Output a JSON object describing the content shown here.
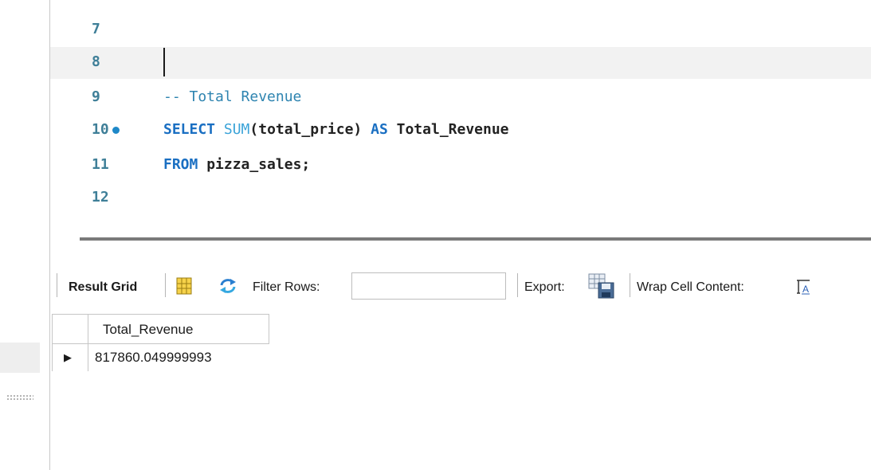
{
  "editor": {
    "lines": [
      {
        "num": "7"
      },
      {
        "num": "8"
      },
      {
        "num": "9",
        "comment": "-- Total Revenue"
      },
      {
        "num": "10",
        "kw_select": "SELECT",
        "fn_sum": "SUM",
        "expr": "(total_price) ",
        "kw_as": "AS",
        "alias": " Total_Revenue"
      },
      {
        "num": "11",
        "kw_from": "FROM",
        "table": " pizza_sales;"
      },
      {
        "num": "12"
      }
    ]
  },
  "toolbar": {
    "result_grid_label": "Result Grid",
    "filter_rows_label": "Filter Rows:",
    "filter_value": "",
    "export_label": "Export:",
    "wrap_label": "Wrap Cell Content:"
  },
  "grid": {
    "columns": [
      "Total_Revenue"
    ],
    "rows": [
      [
        "817860.049999993"
      ]
    ],
    "row_indicator": "▶"
  },
  "icons": {
    "grid_icon": "grid-layout-icon",
    "refresh_icon": "refresh-icon",
    "export_icon": "export-icon",
    "wrap_icon": "wrap-text-icon",
    "breakpoint": "statement-marker-icon"
  },
  "colors": {
    "keyword": "#1a6fc2",
    "function": "#3aa3d8",
    "comment": "#2e84b0",
    "line_number": "#3f7f98",
    "marker": "#1e88c8"
  }
}
